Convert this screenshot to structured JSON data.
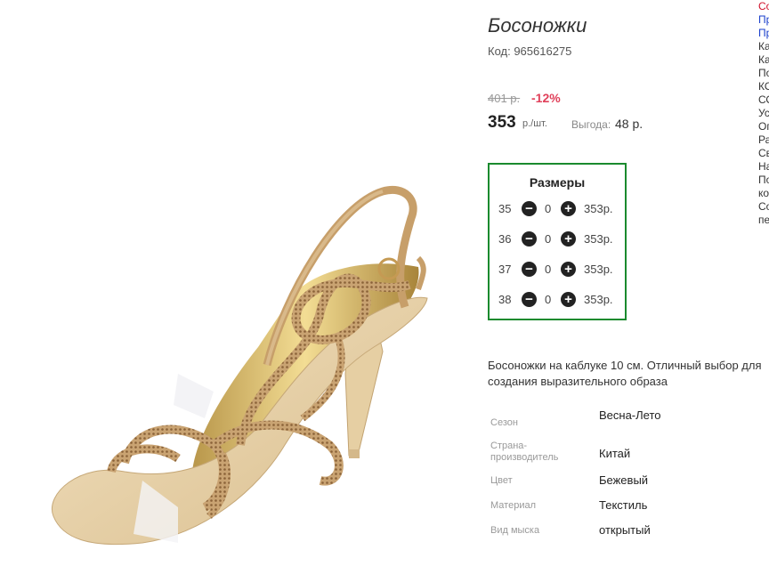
{
  "product": {
    "title": "Босоножки",
    "code": "Код: 965616275",
    "old_price": "401 р.",
    "discount": "-12%",
    "price": "353",
    "unit": "р./шт.",
    "saving_label": "Выгода:",
    "saving_value": "48 р."
  },
  "sizes": {
    "title": "Размеры",
    "rows": [
      {
        "size": "35",
        "qty": "0",
        "price": "353р."
      },
      {
        "size": "36",
        "qty": "0",
        "price": "353р."
      },
      {
        "size": "37",
        "qty": "0",
        "price": "353р."
      },
      {
        "size": "38",
        "qty": "0",
        "price": "353р."
      }
    ],
    "minus_glyph": "−",
    "plus_glyph": "+"
  },
  "description": "Босоножки на каблуке 10 см. Отличный выбор для создания выразительного образа",
  "attributes": [
    {
      "key": "Сезон",
      "value": "Весна-Лето"
    },
    {
      "key": "Страна-производитель",
      "value": "Китай"
    },
    {
      "key": "Цвет",
      "value": "Бежевый"
    },
    {
      "key": "Материал",
      "value": "Текстиль"
    },
    {
      "key": "Вид мыска",
      "value": "открытый"
    }
  ],
  "side_panel": [
    {
      "text": "Со",
      "color": "red"
    },
    {
      "text": "Пр",
      "color": "blue"
    },
    {
      "text": "Пр",
      "color": "blue"
    },
    {
      "text": "Ка",
      "color": "dark"
    },
    {
      "text": "Ка",
      "color": "dark"
    },
    {
      "text": "По",
      "color": "dark"
    },
    {
      "text": "КО",
      "color": "dark"
    },
    {
      "text": "СО",
      "color": "dark"
    },
    {
      "text": "Ус",
      "color": "dark"
    },
    {
      "text": "Оп",
      "color": "dark"
    },
    {
      "text": "Ра",
      "color": "dark"
    },
    {
      "text": "Св",
      "color": "dark"
    },
    {
      "text": "На",
      "color": "dark"
    },
    {
      "text": "По",
      "color": "dark"
    },
    {
      "text": "ко",
      "color": "dark"
    },
    {
      "text": "Со",
      "color": "dark"
    },
    {
      "text": "пе",
      "color": "dark"
    }
  ],
  "colors": {
    "discount": "#e0405a",
    "sizes_border": "#1a8a2e",
    "link_red": "#d0102a",
    "link_blue": "#1a3fcc"
  }
}
